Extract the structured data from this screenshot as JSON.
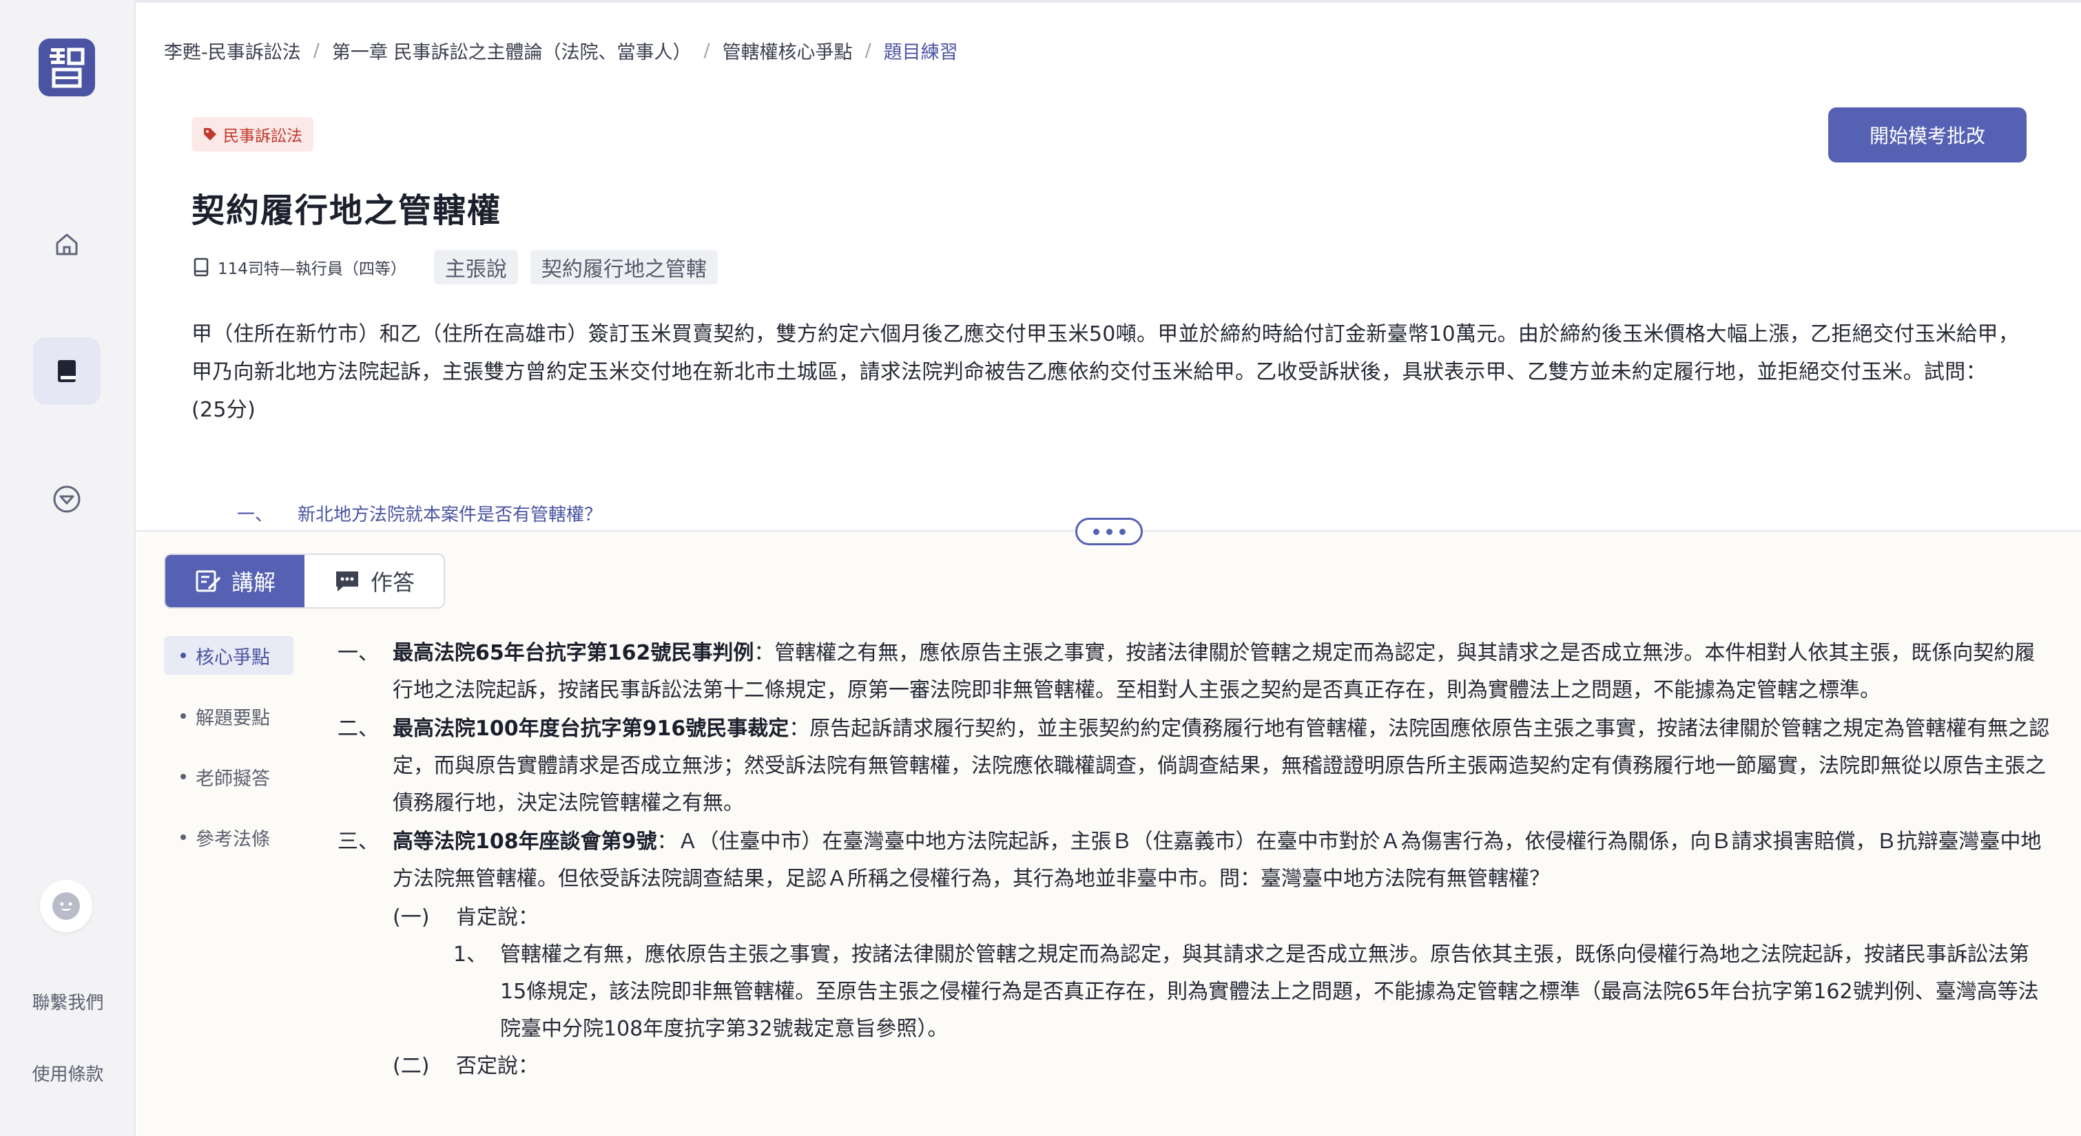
{
  "sidebar": {
    "logo_char": "智",
    "contact": "聯繫我們",
    "terms": "使用條款"
  },
  "breadcrumb": [
    "李甦-民事訴訟法",
    "第一章 民事訴訟之主體論（法院、當事人）",
    "管轄權核心爭點",
    "題目練習"
  ],
  "question": {
    "tag": "民事訴訟法",
    "start_button": "開始模考批改",
    "title": "契約履行地之管轄權",
    "source": "114司特—執行員（四等）",
    "chips": [
      "主張說",
      "契約履行地之管轄"
    ],
    "text": "甲（住所在新竹市）和乙（住所在高雄市）簽訂玉米買賣契約，雙方約定六個月後乙應交付甲玉米50噸。甲並於締約時給付訂金新臺幣10萬元。由於締約後玉米價格大幅上漲，乙拒絕交付玉米給甲，甲乃向新北地方法院起訴，主張雙方曾約定玉米交付地在新北市土城區，請求法院判命被告乙應依約交付玉米給甲。乙收受訴狀後，具狀表示甲、乙雙方並未約定履行地，並拒絕交付玉米。試問：",
    "score": "(25分)",
    "sub_num": "一、",
    "sub_text": "新北地方法院就本案件是否有管轄權？"
  },
  "tabs": {
    "explain": "講解",
    "answer": "作答"
  },
  "subnav": [
    "核心爭點",
    "解題要點",
    "老師擬答",
    "參考法條"
  ],
  "answer": {
    "items": [
      {
        "num": "一、",
        "title": "最高法院65年台抗字第162號民事判例",
        "text": "：管轄權之有無，應依原告主張之事實，按諸法律關於管轄之規定而為認定，與其請求之是否成立無涉。本件相對人依其主張，既係向契約履行地之法院起訴，按諸民事訴訟法第十二條規定，原第一審法院即非無管轄權。至相對人主張之契約是否真正存在，則為實體法上之問題，不能據為定管轄之標準。"
      },
      {
        "num": "二、",
        "title": "最高法院100年度台抗字第916號民事裁定",
        "text": "：原告起訴請求履行契約，並主張契約約定債務履行地有管轄權，法院固應依原告主張之事實，按諸法律關於管轄之規定為管轄權有無之認定，而與原告實體請求是否成立無涉；然受訴法院有無管轄權，法院應依職權調查，倘調查結果，無稽證證明原告所主張兩造契約定有債務履行地一節屬實，法院即無從以原告主張之債務履行地，決定法院管轄權之有無。"
      },
      {
        "num": "三、",
        "title": "高等法院108年座談會第9號",
        "text": "：Ａ（住臺中市）在臺灣臺中地方法院起訴，主張Ｂ（住嘉義市）在臺中市對於Ａ為傷害行為，依侵權行為關係，向Ｂ請求損害賠償，Ｂ抗辯臺灣臺中地方法院無管轄權。但依受訴法院調查結果，足認Ａ所稱之侵權行為，其行為地並非臺中市。問：臺灣臺中地方法院有無管轄權？"
      }
    ],
    "sub1_num": "(一)",
    "sub1_label": "肯定說：",
    "sub1_1_num": "1、",
    "sub1_1_text": "管轄權之有無，應依原告主張之事實，按諸法律關於管轄之規定而為認定，與其請求之是否成立無涉。原告依其主張，既係向侵權行為地之法院起訴，按諸民事訴訟法第15條規定，該法院即非無管轄權。至原告主張之侵權行為是否真正存在，則為實體法上之問題，不能據為定管轄之標準（最高法院65年台抗字第162號判例、臺灣高等法院臺中分院108年度抗字第32號裁定意旨參照）。",
    "sub2_num": "(二)",
    "sub2_label": "否定說："
  }
}
